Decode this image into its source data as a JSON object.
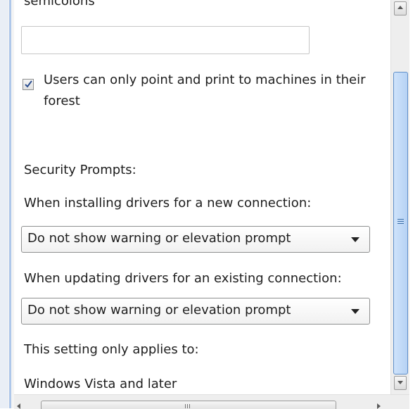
{
  "panel": {
    "cut_heading": "semicolons",
    "server_list_value": "",
    "forest_option": {
      "checked": true,
      "label": "Users can only point and print to machines in their forest"
    },
    "security_prompts_label": "Security Prompts:",
    "install_label": "When installing drivers for a new connection:",
    "install_dropdown_value": "Do not show warning or elevation prompt",
    "update_label": "When updating drivers for an existing connection:",
    "update_dropdown_value": "Do not show warning or elevation prompt",
    "applies_label": "This setting only applies to:",
    "applies_value": "Windows Vista and later"
  },
  "colors": {
    "scroll_thumb": "#b6d2f4",
    "scroll_thumb_border": "#5f8fc9",
    "checkmark": "#2a4d8f"
  },
  "icons": {
    "checkmark": "check-icon",
    "dropdown": "chevron-down-icon",
    "scroll_up": "arrow-up-icon",
    "scroll_down": "arrow-down-icon"
  }
}
